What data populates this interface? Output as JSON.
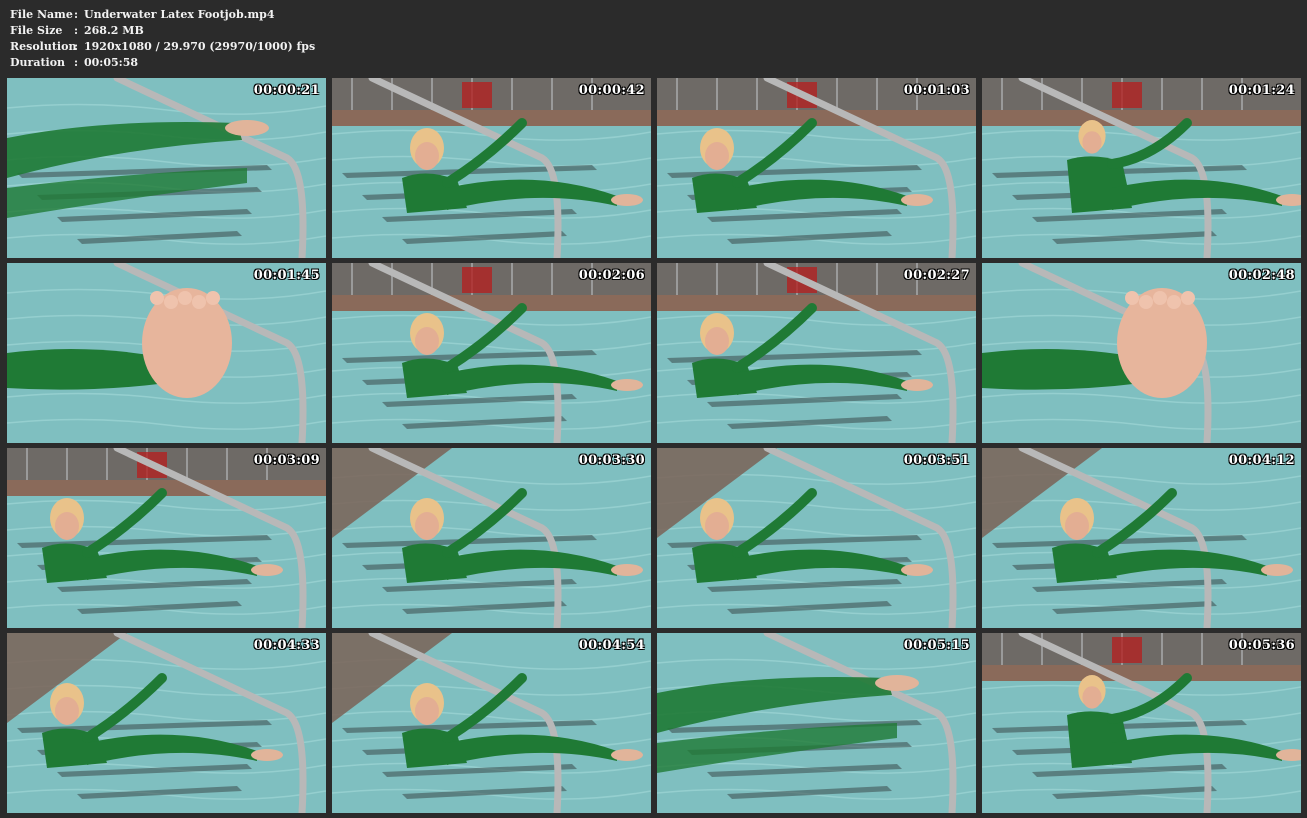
{
  "info": {
    "file_name_label": "File Name",
    "file_name": "Underwater Latex Footjob.mp4",
    "file_size_label": "File Size",
    "file_size": "268.2 MB",
    "resolution_label": "Resolution",
    "resolution": "1920x1080 / 29.970 (29970/1000) fps",
    "duration_label": "Duration",
    "duration": "00:05:58",
    "separator": ":"
  },
  "thumbnails": [
    {
      "timestamp": "00:00:21",
      "scene": "underwater-legs"
    },
    {
      "timestamp": "00:00:42",
      "scene": "pool-steps"
    },
    {
      "timestamp": "00:01:03",
      "scene": "pool-steps"
    },
    {
      "timestamp": "00:01:24",
      "scene": "pool-far"
    },
    {
      "timestamp": "00:01:45",
      "scene": "foot-closeup"
    },
    {
      "timestamp": "00:02:06",
      "scene": "pool-steps"
    },
    {
      "timestamp": "00:02:27",
      "scene": "pool-steps"
    },
    {
      "timestamp": "00:02:48",
      "scene": "sole-closeup"
    },
    {
      "timestamp": "00:03:09",
      "scene": "pool-steps"
    },
    {
      "timestamp": "00:03:30",
      "scene": "steps-recline"
    },
    {
      "timestamp": "00:03:51",
      "scene": "steps-recline"
    },
    {
      "timestamp": "00:04:12",
      "scene": "steps-recline"
    },
    {
      "timestamp": "00:04:33",
      "scene": "steps-recline"
    },
    {
      "timestamp": "00:04:54",
      "scene": "steps-recline"
    },
    {
      "timestamp": "00:05:15",
      "scene": "underwater-legs"
    },
    {
      "timestamp": "00:05:36",
      "scene": "pool-far"
    }
  ],
  "colors": {
    "background": "#2b2b2b",
    "water": "#7fbfc0",
    "suit": "#1f7a35",
    "rail": "#b8b8b8",
    "deck": "#8a6a5a"
  }
}
